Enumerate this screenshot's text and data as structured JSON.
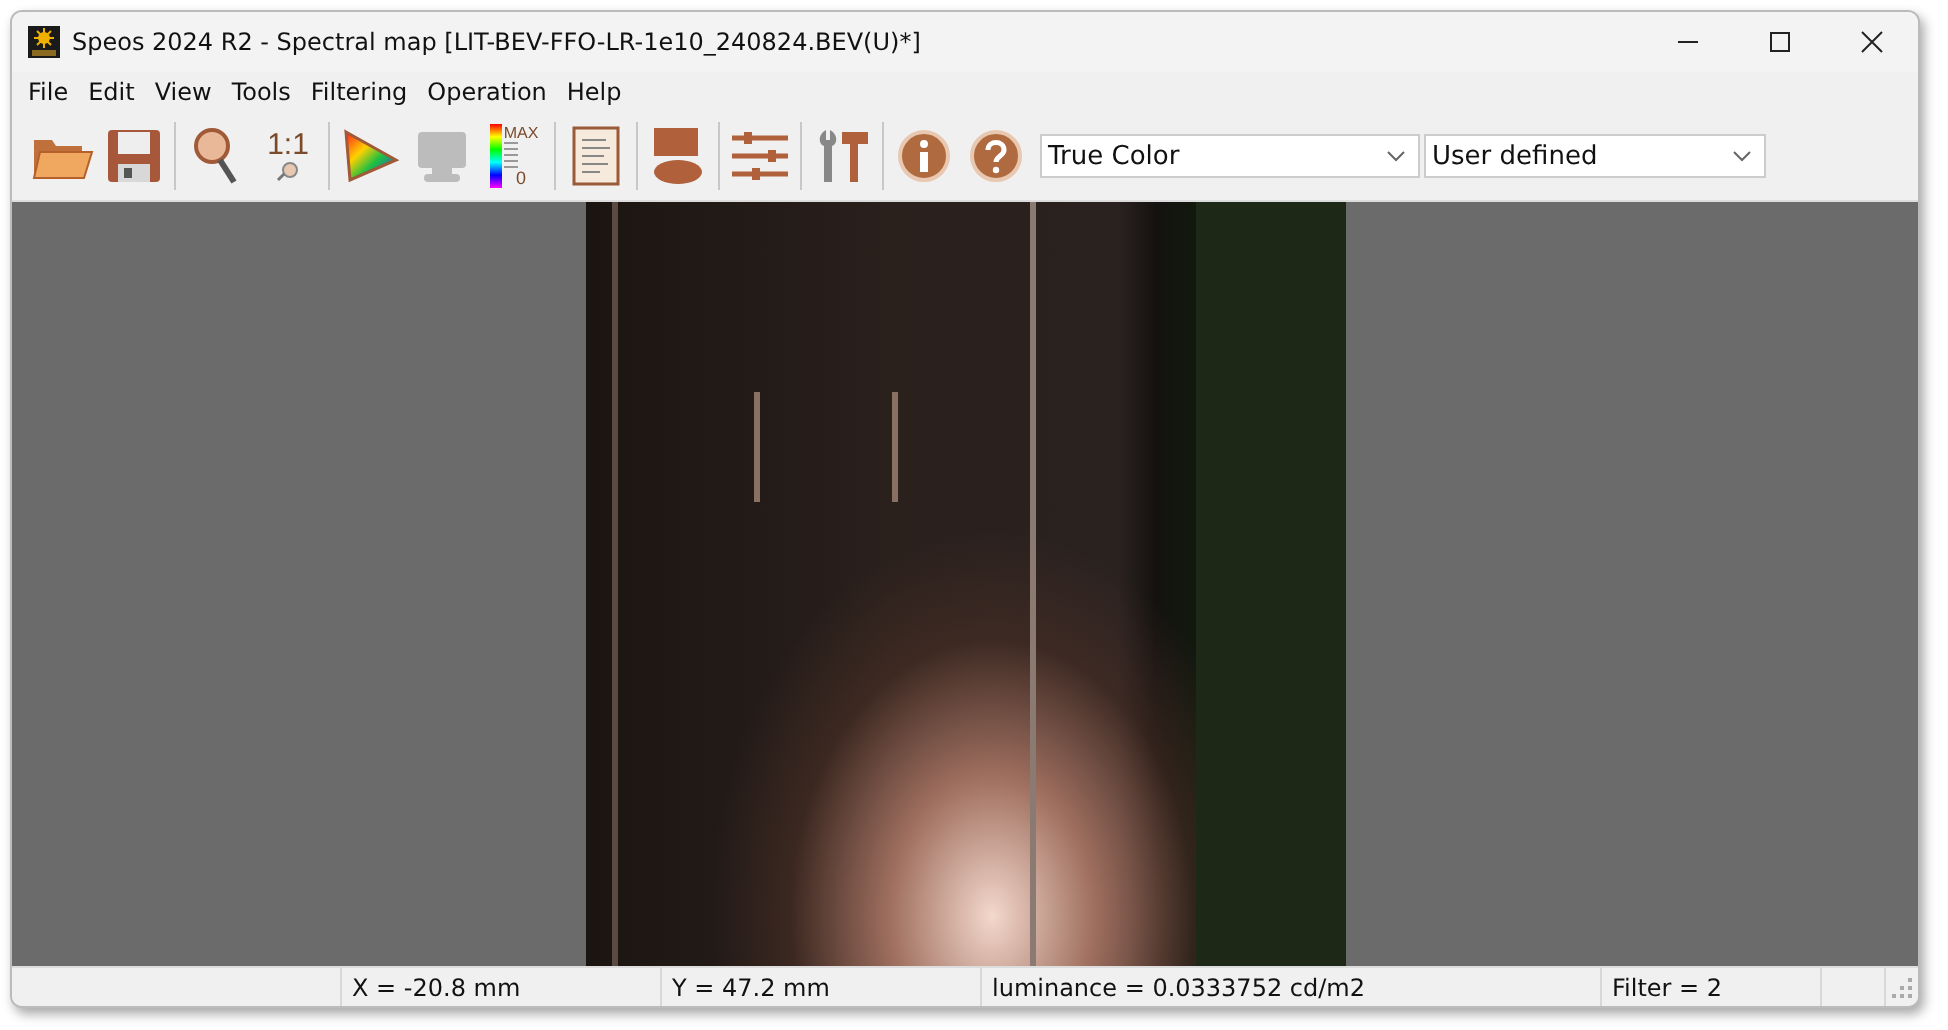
{
  "window": {
    "title": "Speos 2024 R2 - Spectral map [LIT-BEV-FFO-LR-1e10_240824.BEV(U)*]"
  },
  "menu": [
    "File",
    "Edit",
    "View",
    "Tools",
    "Filtering",
    "Operation",
    "Help"
  ],
  "toolbar": [
    {
      "kind": "open",
      "disabled": false
    },
    {
      "kind": "save",
      "disabled": false
    },
    {
      "kind": "sep"
    },
    {
      "kind": "zoom",
      "disabled": false
    },
    {
      "kind": "zoom11",
      "text": "1:1",
      "disabled": false
    },
    {
      "kind": "sep"
    },
    {
      "kind": "color",
      "disabled": false
    },
    {
      "kind": "monitor",
      "disabled": true
    },
    {
      "kind": "scale",
      "text": "MAX",
      "text2": "0",
      "disabled": false
    },
    {
      "kind": "sep"
    },
    {
      "kind": "doc",
      "disabled": false
    },
    {
      "kind": "sep"
    },
    {
      "kind": "shapes",
      "disabled": false
    },
    {
      "kind": "sep"
    },
    {
      "kind": "sliders",
      "disabled": false
    },
    {
      "kind": "sep"
    },
    {
      "kind": "tools",
      "disabled": false
    },
    {
      "kind": "sep"
    },
    {
      "kind": "info",
      "disabled": false
    },
    {
      "kind": "help",
      "disabled": false
    }
  ],
  "dropdowns": [
    {
      "value": "True Color"
    },
    {
      "value": "User defined"
    }
  ],
  "status_bar": [
    "X = -20.8 mm",
    "Y = 47.2 mm",
    "luminance = 0.0333752 cd/m2",
    "Filter = 2"
  ]
}
